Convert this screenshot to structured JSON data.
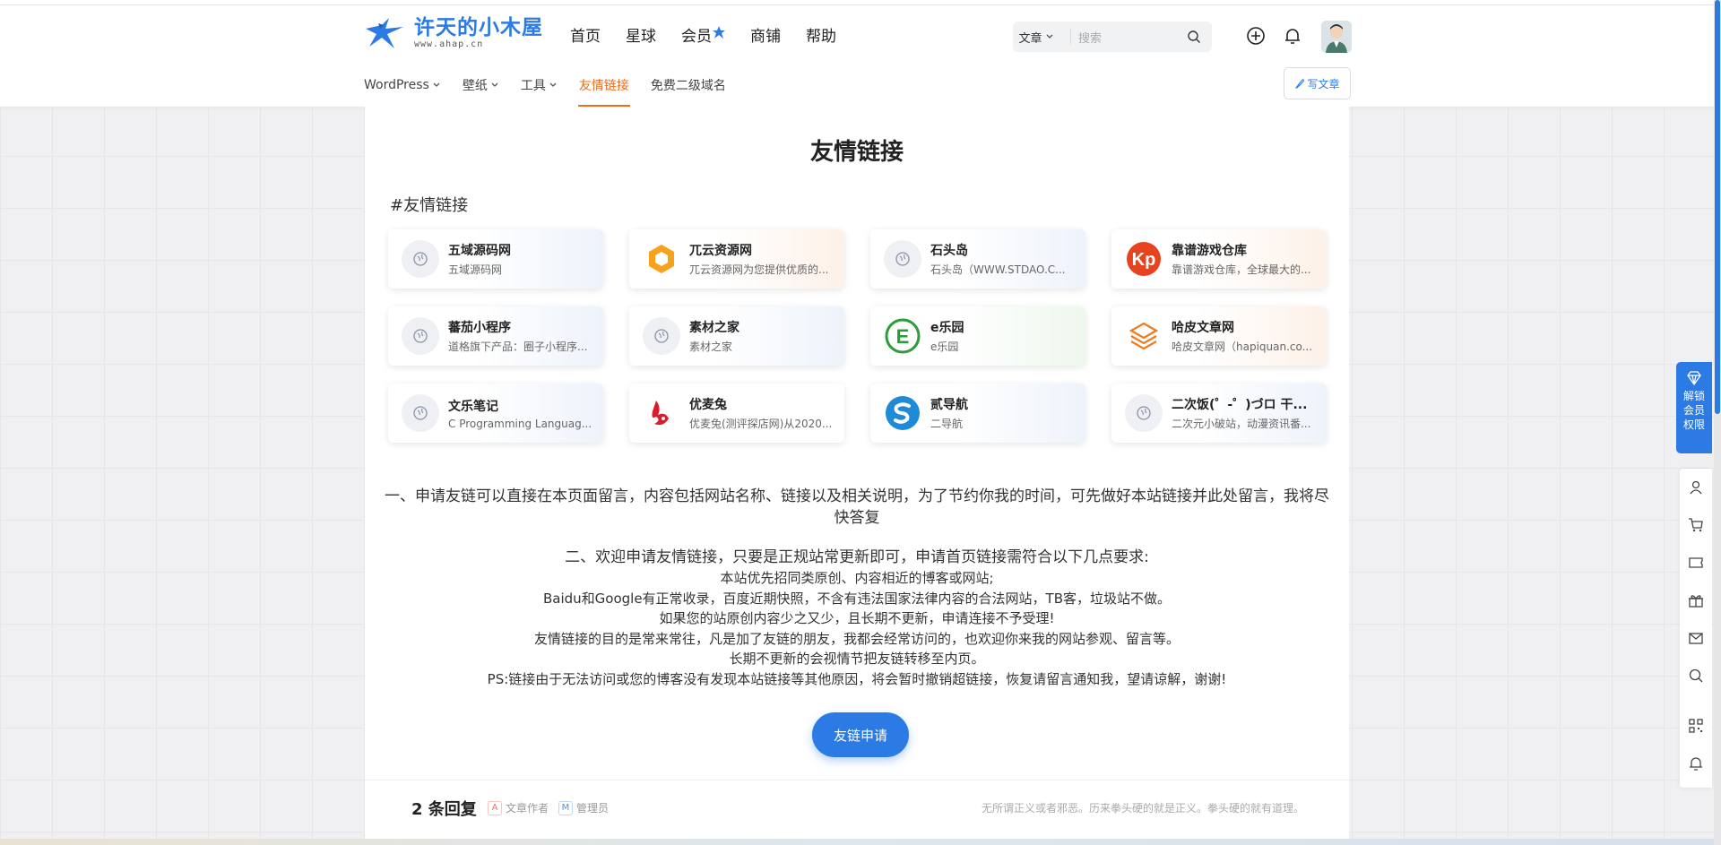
{
  "brand": {
    "title": "许天的小木屋",
    "subtitle": "www.ahap.cn"
  },
  "main_nav": [
    "首页",
    "星球",
    "会员",
    "商铺",
    "帮助"
  ],
  "search": {
    "type": "文章",
    "placeholder": "搜索"
  },
  "sub_nav": [
    {
      "label": "WordPress",
      "dropdown": true
    },
    {
      "label": "壁纸",
      "dropdown": true
    },
    {
      "label": "工具",
      "dropdown": true
    },
    {
      "label": "友情链接",
      "active": true
    },
    {
      "label": "免费二级域名"
    }
  ],
  "write_button": "写文章",
  "page": {
    "title": "友情链接",
    "section": "#友情链接"
  },
  "links": [
    {
      "name": "五域源码网",
      "desc": "五域源码网",
      "icon": "default"
    },
    {
      "name": "兀云资源网",
      "desc": "兀云资源网为您提供优质的...",
      "icon": "hexagon-orange"
    },
    {
      "name": "石头岛",
      "desc": "石头岛（WWW.STDAO.C...",
      "icon": "default"
    },
    {
      "name": "靠谱游戏仓库",
      "desc": "靠谱游戏仓库，全球最大的...",
      "icon": "kp-red"
    },
    {
      "name": "蕃茄小程序",
      "desc": "道格旗下产品：圈子小程序...",
      "icon": "default"
    },
    {
      "name": "素材之家",
      "desc": "素材之家",
      "icon": "default"
    },
    {
      "name": "e乐园",
      "desc": "e乐园",
      "icon": "e-green"
    },
    {
      "name": "哈皮文章网",
      "desc": "哈皮文章网（hapiquan.co...",
      "icon": "layers-orange"
    },
    {
      "name": "文乐笔记",
      "desc": "C Programming Languag...",
      "icon": "default"
    },
    {
      "name": "优麦兔",
      "desc": "优麦兔(测评探店网)从2020...",
      "icon": "rabbit-red"
    },
    {
      "name": "贰导航",
      "desc": "二导航",
      "icon": "s-blue"
    },
    {
      "name": "二次饭(゜-゜)づロ 干...",
      "desc": "二次元小破站，动漫资讯番...",
      "icon": "default"
    }
  ],
  "notice": {
    "p1": "一、申请友链可以直接在本页面留言，内容包括网站名称、链接以及相关说明，为了节约你我的时间，可先做好本站链接并此处留言，我将尽快答复",
    "p2_title": "二、欢迎申请友情链接，只要是正规站常更新即可，申请首页链接需符合以下几点要求:",
    "p2_lines": [
      "本站优先招同类原创、内容相近的博客或网站;",
      "Baidu和Google有正常收录，百度近期快照，不含有违法国家法律内容的合法网站，TB客，垃圾站不做。",
      "如果您的站原创内容少之又少，且长期不更新，申请连接不予受理!",
      "友情链接的目的是常来常往，凡是加了友链的朋友，我都会经常访问的，也欢迎你来我的网站参观、留言等。",
      "长期不更新的会视情节把友链转移至内页。",
      "PS:链接由于无法访问或您的博客没有发现本站链接等其他原因，将会暂时撤销超链接，恢复请留言通知我，望请谅解，谢谢!"
    ]
  },
  "apply_button": "友链申请",
  "comments": {
    "count": "2 条回复",
    "tag_author": "文章作者",
    "tag_author_mark": "A",
    "tag_admin": "管理员",
    "tag_admin_mark": "M",
    "motto": "无所谓正义或者邪恶。历来拳头硬的就是正义。拳头硬的就有道理。"
  },
  "side_vip": "解锁会员权限",
  "colors": {
    "accent": "#2c7be5",
    "active": "#f06c1a"
  }
}
